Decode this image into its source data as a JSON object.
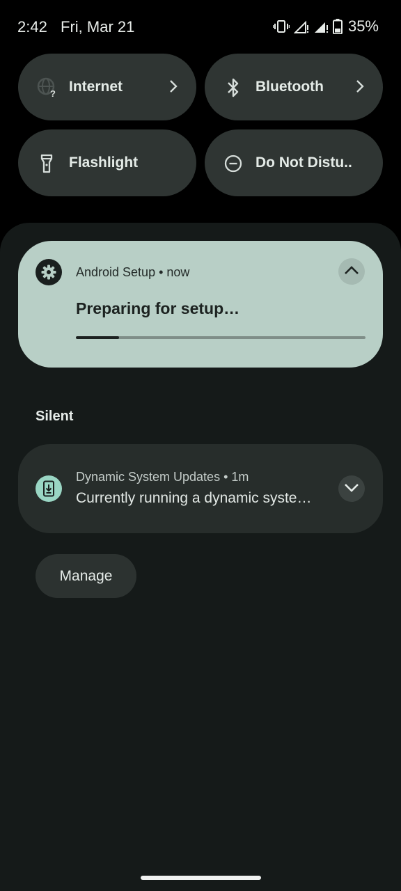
{
  "status_bar": {
    "time": "2:42",
    "date": "Fri, Mar 21",
    "battery_percent": "35%",
    "icons": [
      "vibrate-icon",
      "signal-no-data-icon",
      "signal-no-data-icon",
      "battery-icon"
    ]
  },
  "quick_tiles": [
    {
      "label": "Internet",
      "icon": "globe-question-icon",
      "has_chevron": true
    },
    {
      "label": "Bluetooth",
      "icon": "bluetooth-icon",
      "has_chevron": true
    },
    {
      "label": "Flashlight",
      "icon": "flashlight-icon",
      "has_chevron": false
    },
    {
      "label": "Do Not Distu..",
      "icon": "minus-circle-icon",
      "has_chevron": false
    }
  ],
  "notification_setup": {
    "app_name": "Android Setup • now",
    "title": "Preparing for setup…",
    "icon": "gear-icon",
    "progress": 0.15,
    "accent_color": "#b8cfc6"
  },
  "section": {
    "silent_label": "Silent"
  },
  "notification_dsu": {
    "app_name": "Dynamic System Updates • 1m",
    "text": "Currently running a dynamic syste…",
    "icon": "phone-download-icon"
  },
  "manage_button": {
    "label": "Manage"
  }
}
